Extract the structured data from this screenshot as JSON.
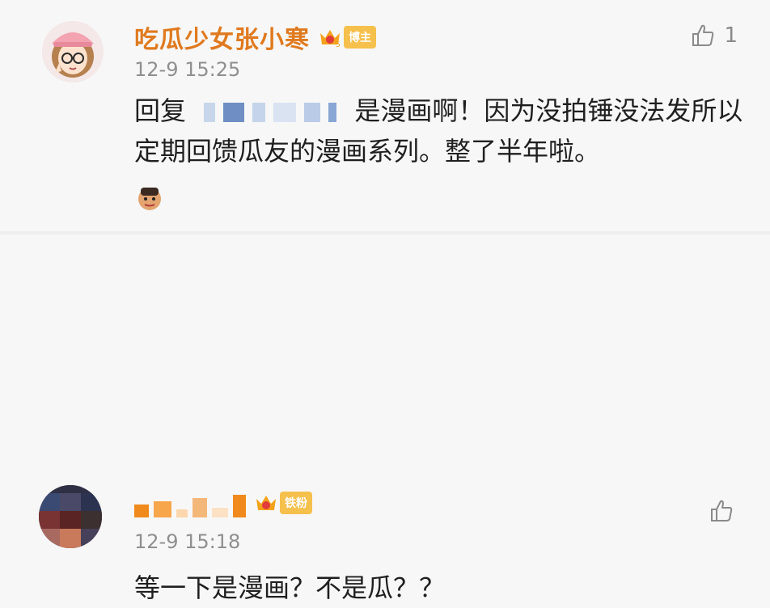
{
  "comments": [
    {
      "username": "吃瓜少女张小寒",
      "badge": "博主",
      "time": "12-9 15:25",
      "text_prefix": "回复",
      "text_body": "是漫画啊！因为没拍锤没法发所以定期回馈瓜友的漫画系列。整了半年啦。",
      "likes": "1",
      "colors": {
        "username": "#e07a1f",
        "badge": "#f6c04c"
      }
    },
    {
      "username": "",
      "badge": "铁粉",
      "time": "12-9 15:18",
      "text_body": "等一下是漫画？不是瓜？？",
      "likes": "",
      "colors": {
        "badge": "#f6c04c"
      }
    }
  ]
}
